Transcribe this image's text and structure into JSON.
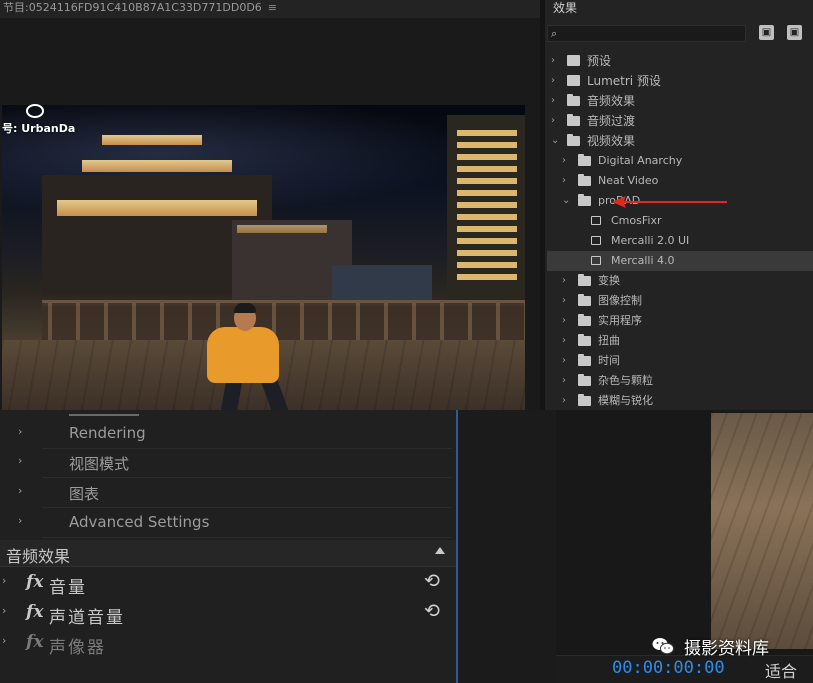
{
  "program_monitor": {
    "title": "节目:0524116FD91C410B87A1C33D771DD0D6",
    "menu_icon": "≡",
    "video_watermark": "号: UrbanDa"
  },
  "effects_panel": {
    "title": "效果",
    "search_placeholder": "",
    "header_buttons": [
      "new-bin-icon",
      "new-custom-bin-icon"
    ],
    "tree": [
      {
        "label": "预设",
        "type": "bin",
        "expanded": false
      },
      {
        "label": "Lumetri 预设",
        "type": "bin",
        "expanded": false
      },
      {
        "label": "音频效果",
        "type": "folder",
        "expanded": false
      },
      {
        "label": "音频过渡",
        "type": "folder",
        "expanded": false
      },
      {
        "label": "视频效果",
        "type": "folder",
        "expanded": true
      },
      {
        "label": "Digital Anarchy",
        "type": "folder",
        "expanded": false
      },
      {
        "label": "Neat Video",
        "type": "folder",
        "expanded": false
      },
      {
        "label": "proDAD",
        "type": "folder",
        "expanded": true
      },
      {
        "label": "CmosFixr",
        "type": "effect"
      },
      {
        "label": "Mercalli 2.0 UI",
        "type": "effect"
      },
      {
        "label": "Mercalli 4.0",
        "type": "effect",
        "selected": true
      },
      {
        "label": "变换",
        "type": "folder",
        "expanded": false
      },
      {
        "label": "图像控制",
        "type": "folder",
        "expanded": false
      },
      {
        "label": "实用程序",
        "type": "folder",
        "expanded": false
      },
      {
        "label": "扭曲",
        "type": "folder",
        "expanded": false
      },
      {
        "label": "时间",
        "type": "folder",
        "expanded": false
      },
      {
        "label": "杂色与颗粒",
        "type": "folder",
        "expanded": false
      },
      {
        "label": "模糊与锐化",
        "type": "folder",
        "expanded": false
      }
    ],
    "annotation_color": "#e0281e"
  },
  "effect_controls": {
    "rows": [
      "Rendering",
      "视图模式",
      "图表",
      "Advanced Settings"
    ],
    "audio_header": "音频效果",
    "audio_rows": [
      {
        "fx": "fx",
        "label": "音量",
        "reset": true
      },
      {
        "fx": "fx",
        "label": "声道音量",
        "reset": true
      },
      {
        "fx": "fx",
        "label": "声像器",
        "reset": false
      }
    ]
  },
  "source_monitor": {
    "timecode": "00:00:00:00",
    "fit": "适合",
    "timecode_color": "#2d8ceb"
  },
  "watermark": {
    "text": "摄影资料库"
  }
}
